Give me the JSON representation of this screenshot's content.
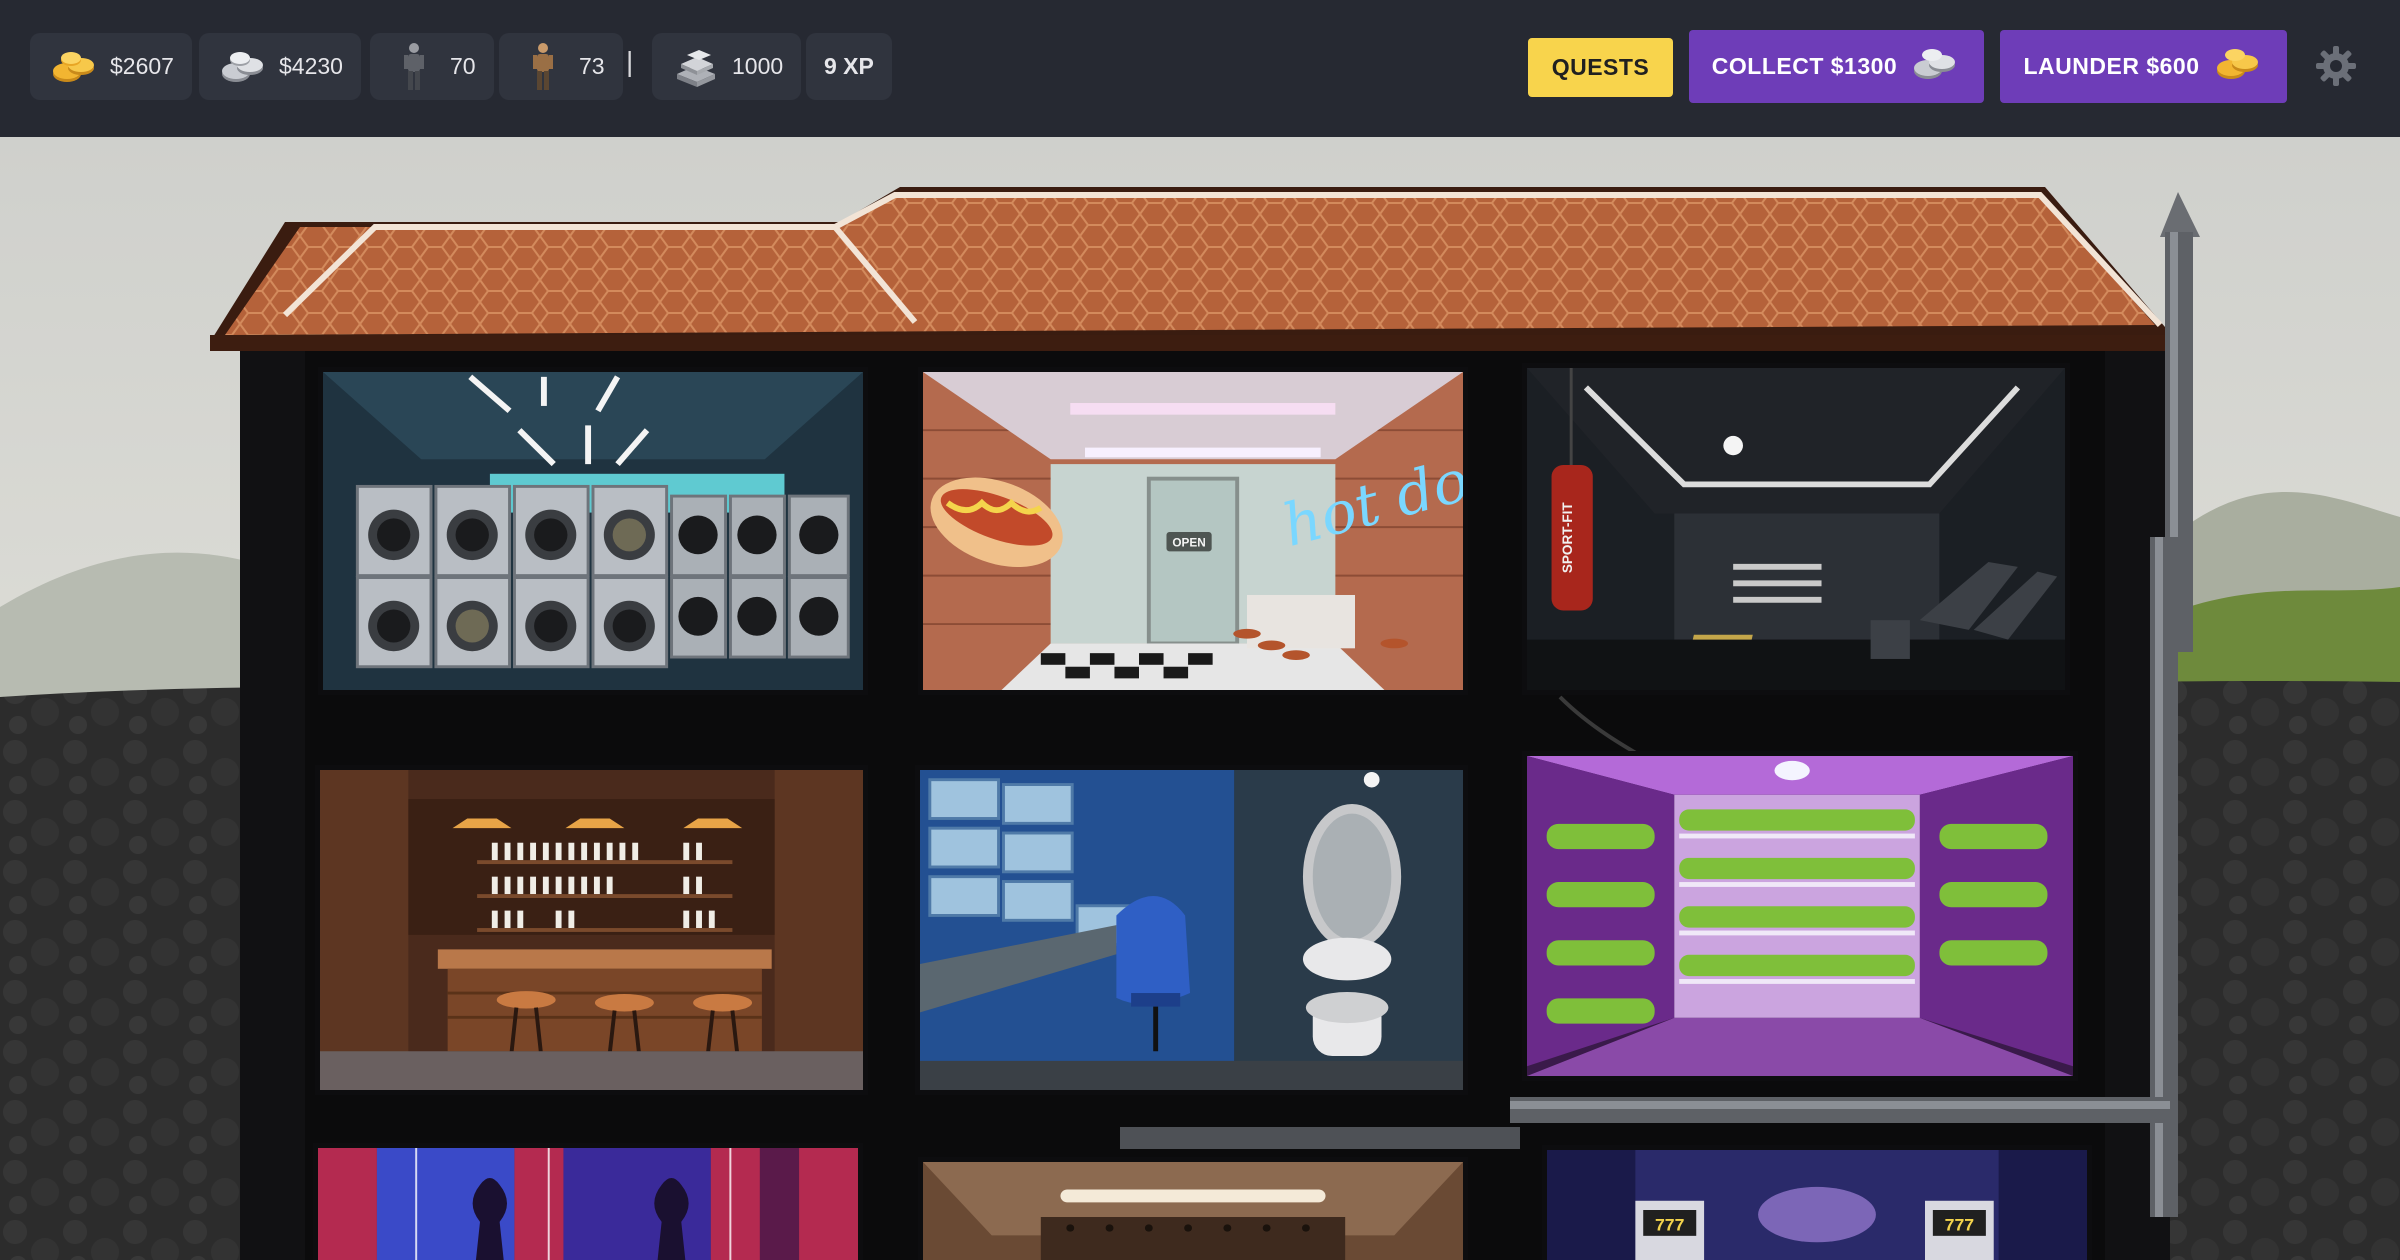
{
  "stats": {
    "gold_cash": "$2607",
    "silver_cash": "$4230",
    "thugs": "70",
    "workers": "73",
    "separator": "|",
    "silver_stack": "1000",
    "xp": "9 XP"
  },
  "buttons": {
    "quests": "QUESTS",
    "collect": "COLLECT $1300",
    "launder": "LAUNDER $600"
  },
  "rooms": [
    {
      "name": "laundromat"
    },
    {
      "name": "hot-dog-shop",
      "sign": "OPEN",
      "neon": "hot dog"
    },
    {
      "name": "gym",
      "bag_text": "SPORT-FIT"
    },
    {
      "name": "bar"
    },
    {
      "name": "security-room"
    },
    {
      "name": "grow-room"
    },
    {
      "name": "strip-club"
    },
    {
      "name": "vault-room"
    },
    {
      "name": "casino",
      "slot_text": "777"
    }
  ],
  "colors": {
    "accent_purple": "#6e3db8",
    "accent_yellow": "#f8d44c",
    "topbar": "#262932",
    "pill": "#30343e"
  },
  "icons": {
    "gold": "gold-coins-icon",
    "silver": "silver-coins-icon",
    "thug": "thug-figure-icon",
    "worker": "worker-figure-icon",
    "stack": "silver-bars-icon",
    "settings": "gear-icon"
  }
}
